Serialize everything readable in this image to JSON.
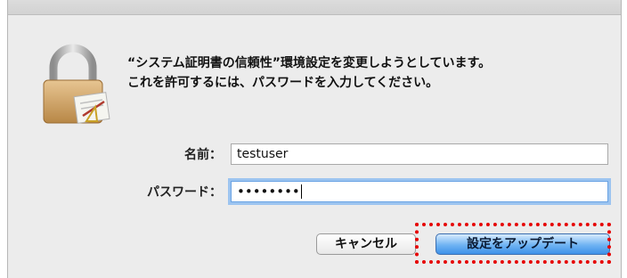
{
  "dialog": {
    "message_line1": "“システム証明書の信頼性”環境設定を変更しようとしています。",
    "message_line2": "これを許可するには、パスワードを入力してください。",
    "lock_icon": "lock-icon"
  },
  "form": {
    "name_label": "名前：",
    "name_value": "testuser",
    "password_label": "パスワード：",
    "password_mask": "••••••••"
  },
  "buttons": {
    "cancel_label": "キャンセル",
    "update_label": "設定をアップデート"
  },
  "colors": {
    "highlight": "#e60000",
    "focus_ring": "#9cc4f0",
    "default_button": "#6fb3f3"
  }
}
